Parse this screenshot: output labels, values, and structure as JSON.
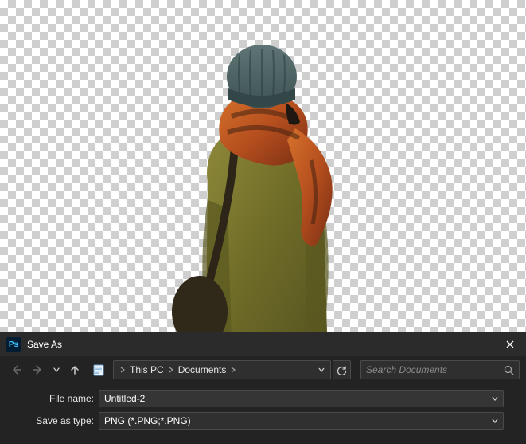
{
  "canvas": {
    "subject_description": "person-from-back-with-transparent-bg"
  },
  "dialog": {
    "title": "Save As",
    "app_icon_label": "Ps",
    "breadcrumb": {
      "items": [
        "This PC",
        "Documents"
      ]
    },
    "search": {
      "placeholder": "Search Documents"
    },
    "fields": {
      "file_name_label": "File name:",
      "file_name_value": "Untitled-2",
      "save_as_type_label": "Save as type:",
      "save_as_type_value": "PNG (*.PNG;*.PNG)"
    }
  }
}
